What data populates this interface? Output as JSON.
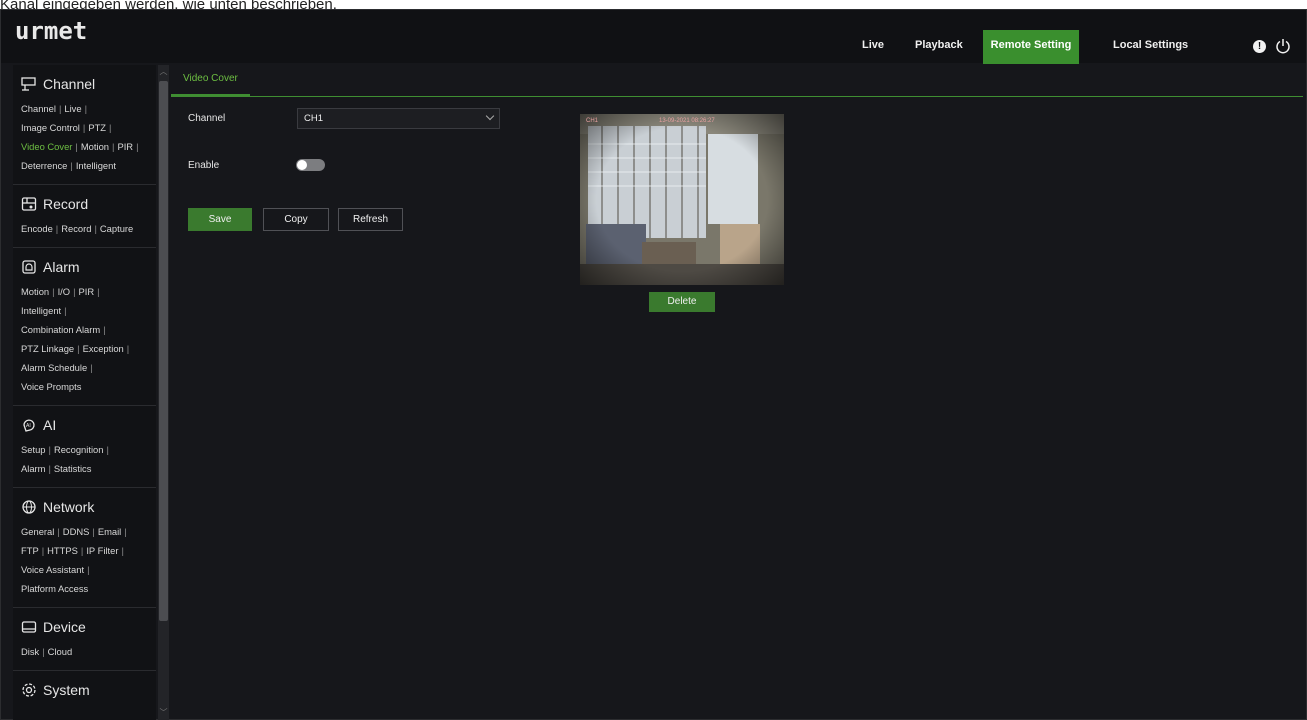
{
  "caption": "Kanal eingegeben werden, wie unten beschrieben.",
  "header": {
    "logo": "urmet",
    "tabs": [
      {
        "label": "Live",
        "active": false
      },
      {
        "label": "Playback",
        "active": false
      },
      {
        "label": "Remote Setting",
        "active": true
      },
      {
        "label": "Local Settings",
        "active": false
      }
    ],
    "info_icon": "info-icon",
    "power_icon": "power-icon"
  },
  "sidebar": {
    "sections": [
      {
        "title": "Channel",
        "icon": "camera-icon",
        "lines": [
          [
            "Channel",
            "Live"
          ],
          [
            "Image Control",
            "PTZ"
          ],
          [
            "Video Cover",
            "Motion",
            "PIR"
          ],
          [
            "Deterrence",
            "Intelligent"
          ]
        ],
        "active_item": "Video Cover"
      },
      {
        "title": "Record",
        "icon": "record-icon",
        "lines": [
          [
            "Encode",
            "Record",
            "Capture"
          ]
        ]
      },
      {
        "title": "Alarm",
        "icon": "alarm-icon",
        "lines": [
          [
            "Motion",
            "I/O",
            "PIR"
          ],
          [
            "Intelligent"
          ],
          [
            "Combination Alarm"
          ],
          [
            "PTZ Linkage",
            "Exception"
          ],
          [
            "Alarm Schedule"
          ],
          [
            "Voice Prompts"
          ]
        ]
      },
      {
        "title": "AI",
        "icon": "ai-icon",
        "lines": [
          [
            "Setup",
            "Recognition"
          ],
          [
            "Alarm",
            "Statistics"
          ]
        ]
      },
      {
        "title": "Network",
        "icon": "network-icon",
        "lines": [
          [
            "General",
            "DDNS",
            "Email"
          ],
          [
            "FTP",
            "HTTPS",
            "IP Filter"
          ],
          [
            "Voice Assistant"
          ],
          [
            "Platform Access"
          ]
        ]
      },
      {
        "title": "Device",
        "icon": "device-icon",
        "lines": [
          [
            "Disk",
            "Cloud"
          ]
        ]
      },
      {
        "title": "System",
        "icon": "gear-icon",
        "lines": []
      }
    ]
  },
  "main": {
    "tab": "Video Cover",
    "channel_label": "Channel",
    "channel_value": "CH1",
    "enable_label": "Enable",
    "enable_on": false,
    "buttons": {
      "save": "Save",
      "copy": "Copy",
      "refresh": "Refresh"
    },
    "preview": {
      "osd_channel": "CH1",
      "osd_time": "13-09-2021 08:26:27"
    },
    "delete_label": "Delete"
  },
  "colors": {
    "accent": "#3a8f2e",
    "active_text": "#6dbf42",
    "background": "#16171b"
  }
}
